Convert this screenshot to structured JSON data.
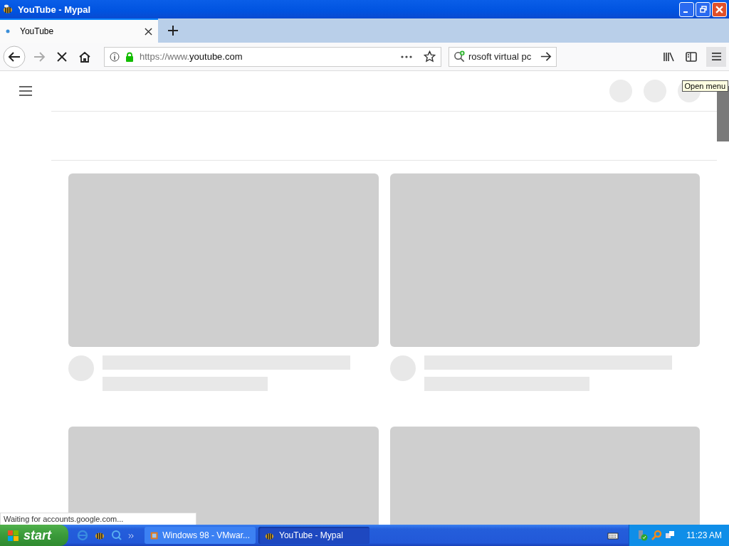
{
  "window": {
    "title": "YouTube - Mypal"
  },
  "tabs": [
    {
      "label": "YouTube",
      "selected": true
    }
  ],
  "toolbar": {
    "loading": true,
    "address": {
      "prefix": "https://www.",
      "domain": "youtube.com"
    },
    "search": {
      "value": "rosoft virtual pc"
    },
    "menu_tooltip": "Open menu"
  },
  "page": {
    "cards": [
      {
        "kind": "full"
      },
      {
        "kind": "full"
      },
      {
        "kind": "thumbnail"
      },
      {
        "kind": "thumbnail"
      }
    ]
  },
  "status_bar": {
    "text": "Waiting for accounts.google.com..."
  },
  "taskbar": {
    "start": "start",
    "tasks": [
      {
        "label": "Windows 98 - VMwar...",
        "selected": false,
        "kind": "vm"
      },
      {
        "label": "YouTube - Mypal",
        "selected": true,
        "kind": "browser"
      }
    ],
    "clock": "11:23 AM"
  }
}
